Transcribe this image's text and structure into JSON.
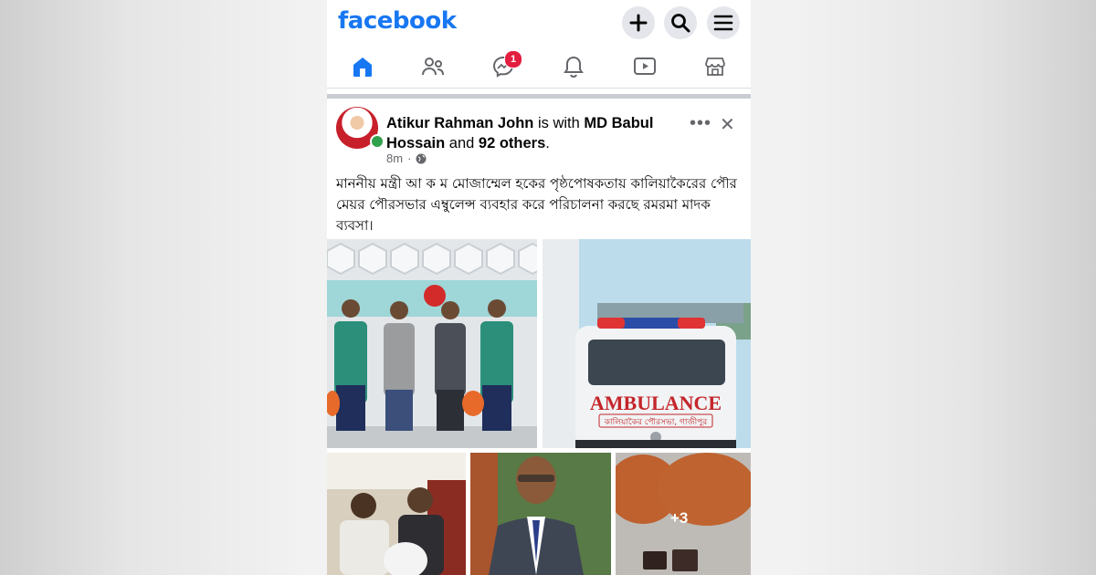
{
  "header": {
    "logo": "facebook",
    "actions": [
      {
        "name": "create",
        "icon": "plus-icon"
      },
      {
        "name": "search",
        "icon": "search-icon"
      },
      {
        "name": "menu",
        "icon": "hamburger-menu-icon"
      }
    ]
  },
  "nav": {
    "tabs": [
      {
        "name": "home",
        "icon": "home-icon",
        "active": true
      },
      {
        "name": "friends",
        "icon": "friends-icon"
      },
      {
        "name": "messenger",
        "icon": "messenger-icon",
        "badge": "1"
      },
      {
        "name": "notifications",
        "icon": "bell-icon"
      },
      {
        "name": "watch",
        "icon": "video-icon"
      },
      {
        "name": "marketplace",
        "icon": "marketplace-icon"
      }
    ]
  },
  "post": {
    "author": "Atikur Rahman John",
    "with_text": "is with",
    "tagged": "MD Babul Hossain",
    "and_text": "and",
    "others": "92 others",
    "end_punct": ".",
    "time": "8m",
    "audience_icon": "globe-icon",
    "text": "মাননীয় মন্ত্রী আ ক ম মোজাম্মেল হকের পৃষ্ঠপোষকতায় কালিয়াকৈরের পৌর মেয়র পৌরসভার এম্বুলেন্স ব্যবহার করে পরিচালনা করছে রমরমা মাদক ব্যবসা।",
    "photos": {
      "ambulance_label": "AMBULANCE",
      "ambulance_sub": "কালিয়াকৈর পৌরসভা, গাজীপুর",
      "more_count": "+3"
    }
  },
  "colors": {
    "brand": "#1877f2",
    "badge": "#e41e3f",
    "online": "#31a24c"
  }
}
